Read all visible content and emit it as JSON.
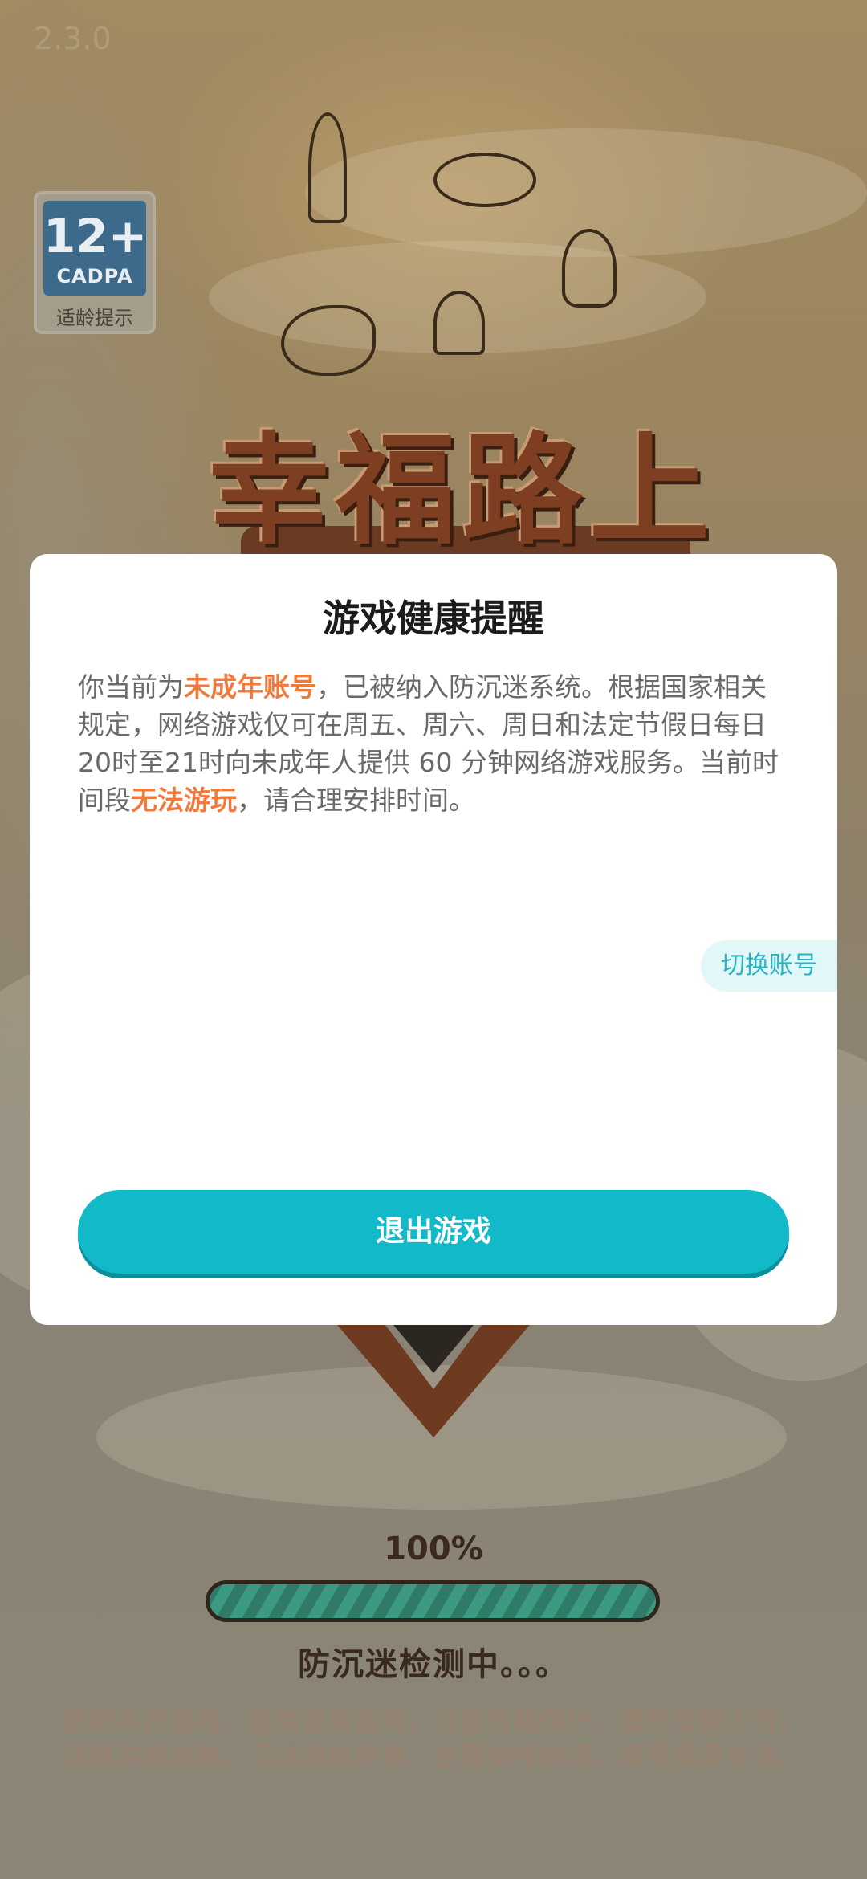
{
  "app": {
    "version": "2.3.0",
    "age_rating": {
      "number": "12+",
      "code": "CADPA",
      "tip": "适龄提示"
    },
    "game_title": "幸福路上"
  },
  "loader": {
    "percent_text": "100%",
    "progress": 1.0,
    "status": "防沉迷检测中。。。"
  },
  "slogan": {
    "line1": "抵制不良游戏，拒绝盗版游戏。注意自我保护，谨防受骗上当。",
    "line2": "适度游戏益脑，沉迷游戏伤身。合理安排时间，享受健康生活。"
  },
  "modal": {
    "title": "游戏健康提醒",
    "body": {
      "p1": "你当前为",
      "hl1": "未成年账号",
      "p2": "，已被纳入防沉迷系统。根据国家相关规定，网络游戏仅可在周五、周六、周日和法定节假日每日20时至21时向未成年人提供 60 分钟网络游戏服务。当前时间段",
      "hl2": "无法游玩",
      "p3": "，请合理安排时间。"
    },
    "switch_account_label": "切换账号",
    "exit_label": "退出游戏"
  },
  "colors": {
    "accent": "#12b9c8",
    "highlight": "#f07a3c",
    "switch_bg": "#e2f7f8"
  }
}
